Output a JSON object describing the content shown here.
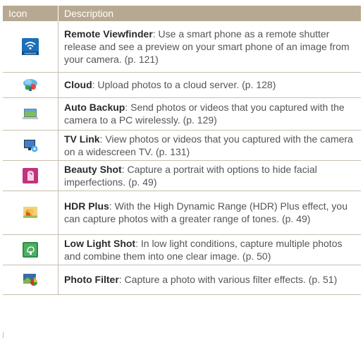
{
  "header": {
    "icon": "Icon",
    "description": "Description"
  },
  "rows": [
    {
      "name": "Remote Viewfinder",
      "text": ": Use a smart phone as a remote shutter release and see a preview on your smart phone of an image from your camera. (p. 121)",
      "icon": "remote-viewfinder-icon",
      "icon_label": "SAMSUNG"
    },
    {
      "name": "Cloud",
      "text": ": Upload photos to a cloud server. (p. 128)",
      "icon": "cloud-icon"
    },
    {
      "name": "Auto Backup",
      "text": ": Send photos or videos that you captured with the camera to a PC wirelessly. (p. 129)",
      "icon": "auto-backup-icon"
    },
    {
      "name": "TV Link",
      "text": ": View photos or videos that you captured with the camera on a widescreen TV. (p. 131)",
      "icon": "tv-link-icon"
    },
    {
      "name": "Beauty Shot",
      "text": ": Capture a portrait with options to hide facial imperfections. (p. 49)",
      "icon": "beauty-shot-icon"
    },
    {
      "name": "HDR Plus",
      "text": ": With the High Dynamic Range (HDR) Plus effect, you can capture photos with a greater range of tones. (p. 49)",
      "icon": "hdr-plus-icon"
    },
    {
      "name": "Low Light Shot",
      "text": ": In low light conditions, capture multiple photos and combine them into one clear image. (p. 50)",
      "icon": "low-light-shot-icon"
    },
    {
      "name": "Photo Filter",
      "text": ": Capture a photo with various filter effects. (p. 51)",
      "icon": "photo-filter-icon"
    }
  ],
  "colors": {
    "header_bg": "#b7a891",
    "rule": "#c9bfae",
    "name_text": "#2b2b2b",
    "body_text": "#555555"
  }
}
